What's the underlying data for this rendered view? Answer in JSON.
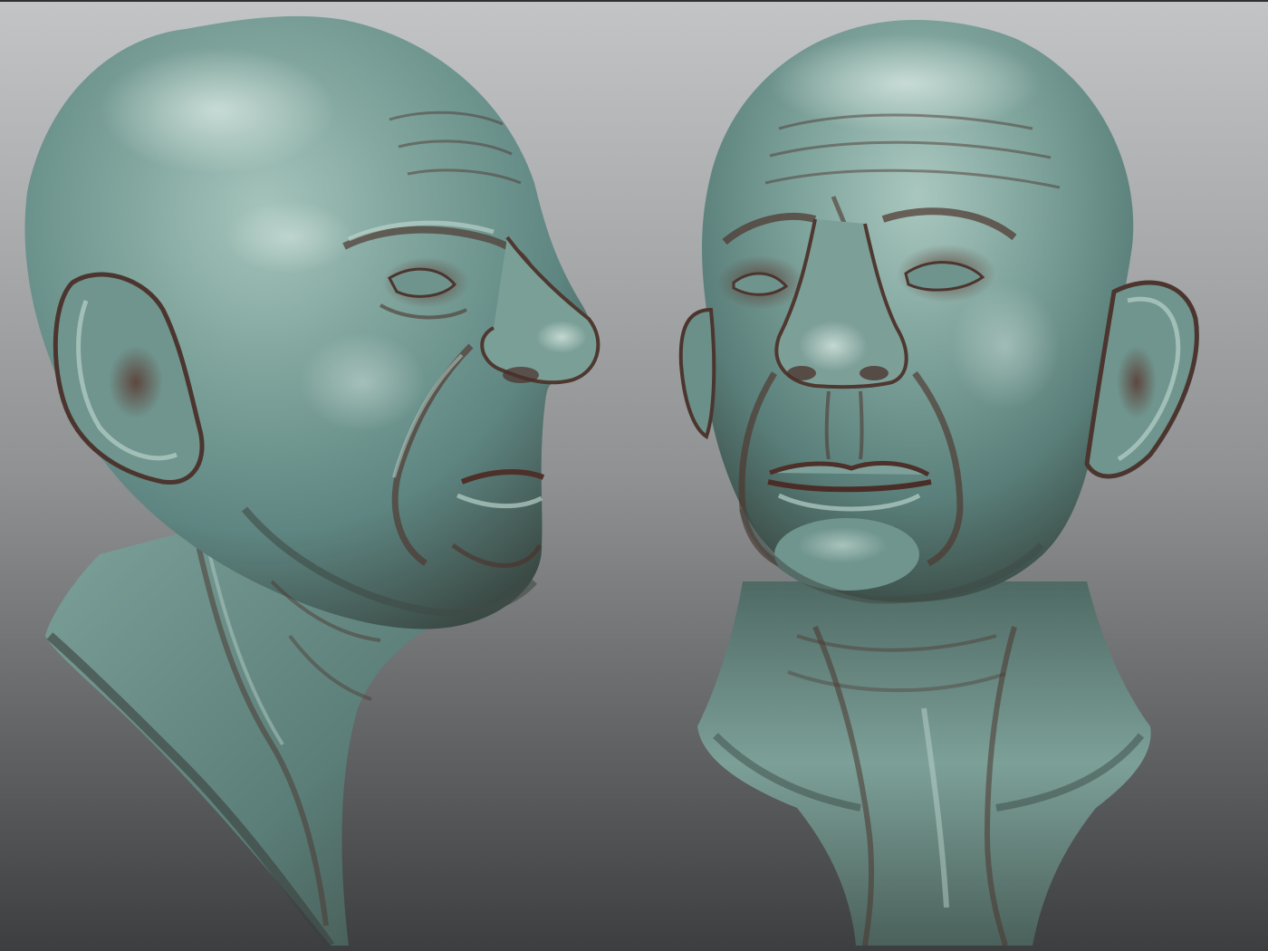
{
  "viewport": {
    "background_top": "#c2c4c6",
    "background_mid": "#8f9193",
    "background_bottom": "#3c3e40",
    "frame_color": "#2e3032"
  },
  "material": {
    "base": "#5e8581",
    "highlight": "#a5c4bc",
    "shadow": "#3b4a45",
    "cavity": "#6a4238",
    "rim": "#c9ddd6"
  },
  "objects": [
    {
      "name": "sculpted-head-profile",
      "view": "three-quarter-profile"
    },
    {
      "name": "sculpted-head-front",
      "view": "three-quarter-front"
    }
  ]
}
